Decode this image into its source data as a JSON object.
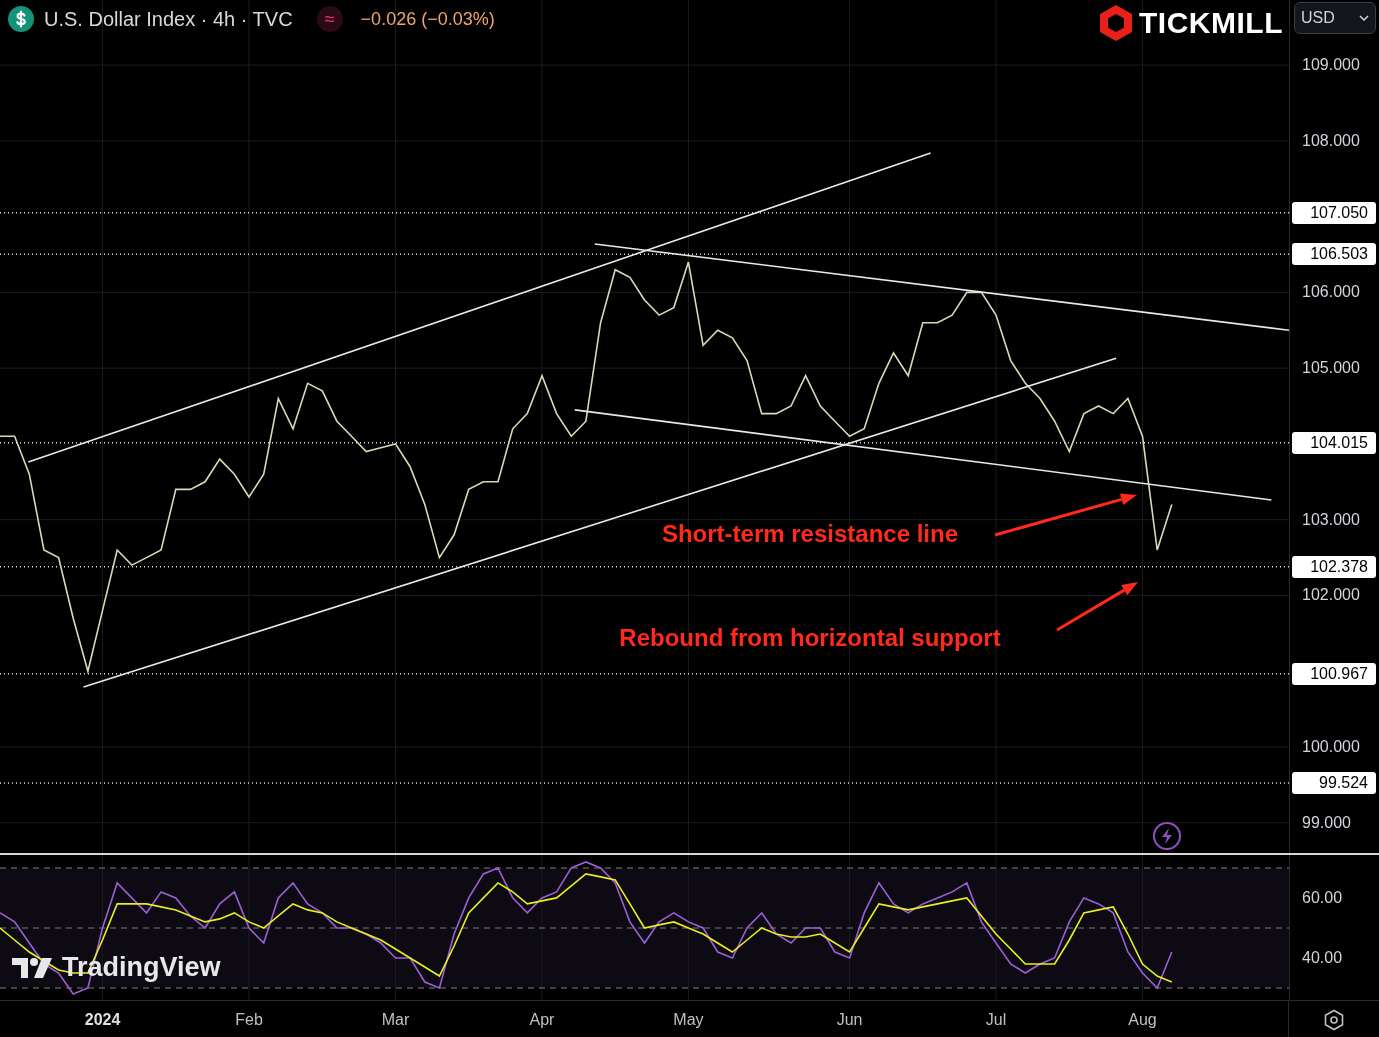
{
  "header": {
    "title": "U.S. Dollar Index · 4h · TVC",
    "change_symbol": "≈",
    "change": "−0.026 (−0.03%)"
  },
  "brand": {
    "name": "TICKMILL"
  },
  "currency_select": {
    "value": "USD"
  },
  "price_chart": {
    "chart_data": {
      "type": "line",
      "categories": [
        null,
        null,
        null,
        null,
        null,
        null,
        null,
        null,
        null,
        null,
        null,
        null,
        null,
        null,
        null,
        null,
        null,
        null,
        null,
        null,
        null,
        null,
        null,
        null,
        null,
        null,
        null,
        null,
        null,
        null,
        null,
        null,
        null,
        null,
        null,
        null,
        null,
        null,
        null,
        null,
        null,
        null,
        null,
        null,
        null,
        null,
        null,
        null,
        null,
        null,
        null,
        null,
        null,
        null,
        null,
        null,
        null,
        null,
        null,
        null,
        null,
        null,
        null,
        null,
        null,
        null,
        null,
        null,
        null,
        null,
        null,
        null,
        null,
        null,
        null,
        null,
        null,
        null,
        null,
        null,
        null
      ],
      "series": [
        {
          "color": "#d4dcb4",
          "values": [
            104.1,
            104.1,
            103.6,
            102.6,
            102.5,
            101.7,
            101.0,
            101.8,
            102.6,
            102.4,
            102.5,
            102.6,
            103.4,
            103.4,
            103.5,
            103.8,
            103.6,
            103.3,
            103.6,
            104.6,
            104.2,
            104.8,
            104.7,
            104.3,
            104.1,
            103.9,
            103.95,
            104.0,
            103.7,
            103.2,
            102.5,
            102.8,
            103.4,
            103.5,
            103.5,
            104.2,
            104.4,
            104.9,
            104.4,
            104.1,
            104.3,
            105.6,
            106.3,
            106.2,
            105.9,
            105.7,
            105.8,
            106.4,
            105.3,
            105.5,
            105.4,
            105.1,
            104.4,
            104.4,
            104.5,
            104.9,
            104.5,
            104.3,
            104.1,
            104.2,
            104.8,
            105.2,
            104.9,
            105.6,
            105.6,
            105.7,
            106.0,
            106.0,
            105.7,
            105.1,
            104.8,
            104.6,
            104.3,
            103.9,
            104.4,
            104.5,
            104.4,
            104.6,
            104.1,
            102.6,
            103.2
          ]
        }
      ],
      "ylim": [
        98.6,
        109.86
      ],
      "yticks": [
        {
          "value": 109,
          "label": "109.000"
        },
        {
          "value": 108,
          "label": "108.000"
        },
        {
          "value": 106,
          "label": "106.000"
        },
        {
          "value": 105,
          "label": "105.000"
        },
        {
          "value": 103,
          "label": "103.000"
        },
        {
          "value": 102,
          "label": "102.000"
        },
        {
          "value": 100,
          "label": "100.000"
        },
        {
          "value": 99,
          "label": "99.000"
        }
      ],
      "grid": true,
      "ref_lines": [
        {
          "axis": "y",
          "value": 107.05,
          "label": "107.050"
        },
        {
          "axis": "y",
          "value": 106.503,
          "label": "106.503"
        },
        {
          "axis": "y",
          "value": 104.015,
          "label": "104.015"
        },
        {
          "axis": "y",
          "value": 102.378,
          "label": "102.378"
        },
        {
          "axis": "y",
          "value": 100.967,
          "label": "100.967"
        },
        {
          "axis": "y",
          "value": 99.524,
          "label": "99.524"
        }
      ],
      "annotations": [
        "Short-term resistance line",
        "Rebound from horizontal support"
      ]
    }
  },
  "rsi_chart": {
    "chart_data": {
      "type": "line",
      "categories": [
        null,
        null,
        null,
        null,
        null,
        null,
        null,
        "2024",
        null,
        null,
        null,
        null,
        null,
        null,
        null,
        null,
        null,
        "Feb",
        null,
        null,
        null,
        null,
        null,
        null,
        null,
        null,
        null,
        "Mar",
        null,
        null,
        null,
        null,
        null,
        null,
        null,
        null,
        null,
        "Apr",
        null,
        null,
        null,
        null,
        null,
        null,
        null,
        null,
        null,
        "May",
        null,
        null,
        null,
        null,
        null,
        null,
        null,
        null,
        null,
        null,
        "Jun",
        null,
        null,
        null,
        null,
        null,
        null,
        null,
        null,
        null,
        "Jul",
        null,
        null,
        null,
        null,
        null,
        null,
        null,
        null,
        null,
        "Aug",
        null,
        null
      ],
      "series": [
        {
          "color": "#9c5fd6",
          "values": [
            55,
            52,
            45,
            38,
            35,
            28,
            30,
            50,
            65,
            60,
            55,
            62,
            60,
            54,
            50,
            58,
            62,
            50,
            45,
            60,
            65,
            58,
            55,
            50,
            50,
            48,
            45,
            40,
            40,
            32,
            30,
            48,
            60,
            68,
            70,
            60,
            55,
            60,
            62,
            70,
            72,
            70,
            65,
            52,
            45,
            52,
            55,
            52,
            50,
            42,
            40,
            50,
            55,
            48,
            45,
            50,
            50,
            42,
            40,
            55,
            65,
            58,
            55,
            58,
            60,
            62,
            65,
            52,
            45,
            38,
            35,
            38,
            40,
            52,
            60,
            58,
            55,
            42,
            35,
            30,
            42
          ]
        },
        {
          "color": "#e8f020",
          "values": [
            50,
            46,
            42,
            39,
            36,
            35,
            35,
            46,
            58,
            58,
            58,
            57,
            56,
            54,
            52,
            53,
            55,
            52,
            50,
            54,
            58,
            56,
            55,
            52,
            50,
            48,
            46,
            43,
            40,
            37,
            34,
            44,
            55,
            60,
            65,
            62,
            58,
            59,
            60,
            64,
            68,
            67,
            66,
            58,
            50,
            51,
            52,
            50,
            48,
            45,
            42,
            46,
            50,
            48,
            47,
            47,
            48,
            45,
            42,
            50,
            58,
            57,
            56,
            57,
            58,
            59,
            60,
            54,
            48,
            43,
            38,
            38,
            38,
            46,
            55,
            56,
            57,
            48,
            38,
            34,
            32
          ]
        }
      ],
      "ylim": [
        26,
        74.3
      ],
      "yticks": [
        {
          "value": 60,
          "label": "60.00"
        },
        {
          "value": 40,
          "label": "40.00"
        }
      ],
      "grid": true,
      "ref_lines": [
        {
          "axis": "y",
          "value": 70
        },
        {
          "axis": "y",
          "value": 50
        },
        {
          "axis": "y",
          "value": 30
        }
      ]
    }
  },
  "logo": {
    "name": "TradingView"
  }
}
